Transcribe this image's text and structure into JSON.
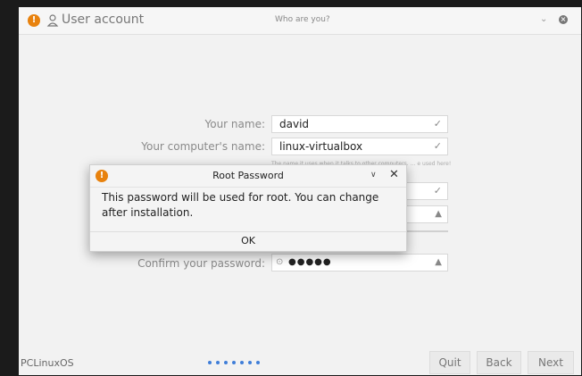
{
  "window": {
    "title": "User account",
    "subtitle": "Who are you?",
    "chevron_glyph": "⌄",
    "close_glyph": "×"
  },
  "form": {
    "name_label": "Your name:",
    "name_value": "david",
    "computer_label": "Your computer's name:",
    "computer_value": "linux-virtualbox",
    "hint_text": "The name it uses when it talks to other computers. … e used here!",
    "confirm_label": "Confirm your password:",
    "password_dots": "●●●●●",
    "check_glyph": "✓",
    "warn_glyph": "▲"
  },
  "dialog": {
    "title": "Root Password",
    "message": "This password will be used for root.  You can change after installation.",
    "ok_label": "OK",
    "chevron_glyph": "∨",
    "close_glyph": "✕"
  },
  "footer": {
    "brand": "PCLinuxOS",
    "step_count": 7,
    "quit_label": "Quit",
    "back_label": "Back",
    "next_label": "Next"
  },
  "colors": {
    "accent": "#e8820e",
    "progress_dot": "#3f7ed8"
  },
  "icons": [
    "warning-icon",
    "user-icon",
    "chevron-down-icon",
    "close-icon",
    "check-icon",
    "eye-icon"
  ]
}
